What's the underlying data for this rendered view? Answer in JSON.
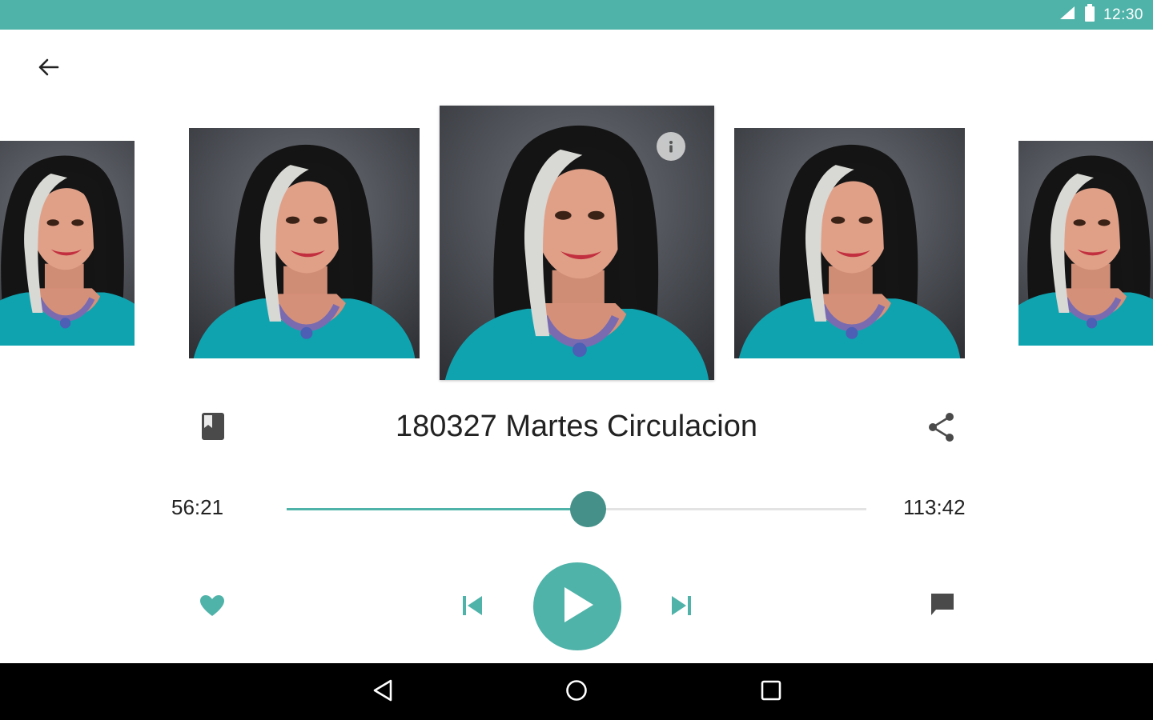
{
  "status_bar": {
    "time": "12:30",
    "signal_icon": "signal-icon",
    "battery_icon": "battery-icon"
  },
  "header": {
    "back_icon": "arrow-left-icon"
  },
  "carousel": {
    "image_description": "podcast cover portrait",
    "info_icon": "info-icon"
  },
  "track": {
    "title": "180327 Martes Circulacion",
    "book_icon": "book-icon",
    "share_icon": "share-icon"
  },
  "player": {
    "elapsed": "56:21",
    "total": "113:42",
    "progress": 0.52,
    "controls": {
      "favorite_icon": "heart-icon",
      "previous_icon": "skip-previous-icon",
      "play_icon": "play-icon",
      "next_icon": "skip-next-icon",
      "comment_icon": "comment-icon"
    }
  },
  "colors": {
    "accent": "#4fb3a9",
    "thumb": "#45918a",
    "track_bg": "#e3e3e3",
    "nav_bar": "#000000"
  },
  "nav_bar": {
    "back_icon": "nav-back-icon",
    "home_icon": "nav-home-icon",
    "recents_icon": "nav-recents-icon"
  }
}
